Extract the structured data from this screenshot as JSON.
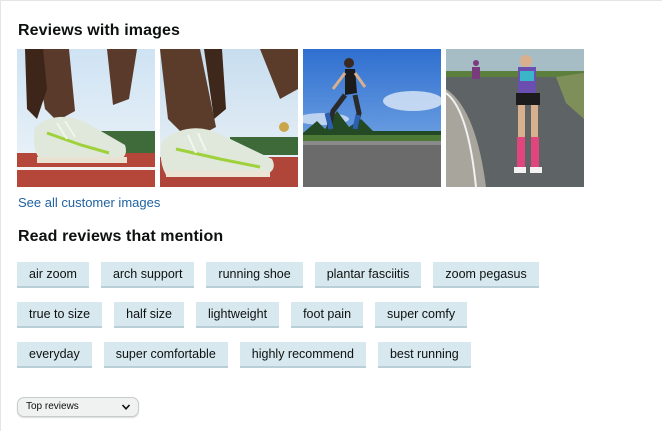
{
  "images_section": {
    "title": "Reviews with images",
    "thumbnails": [
      {
        "icon": "photo-runner-lacing-shoe"
      },
      {
        "icon": "photo-shoe-on-track"
      },
      {
        "icon": "photo-runner-on-track"
      },
      {
        "icon": "photo-runner-on-road"
      }
    ],
    "see_all_label": "See all customer images"
  },
  "mentions_section": {
    "title": "Read reviews that mention",
    "tag_rows": [
      [
        "air zoom",
        "arch support",
        "running shoe",
        "plantar fasciitis",
        "zoom pegasus"
      ],
      [
        "true to size",
        "half size",
        "lightweight",
        "foot pain",
        "super comfy"
      ],
      [
        "everyday",
        "super comfortable",
        "highly recommend",
        "best running"
      ]
    ]
  },
  "sort": {
    "selected": "Top reviews"
  },
  "colors": {
    "link": "#2162a1",
    "tag_background": "#d7e8ee",
    "text": "#0f1111"
  }
}
